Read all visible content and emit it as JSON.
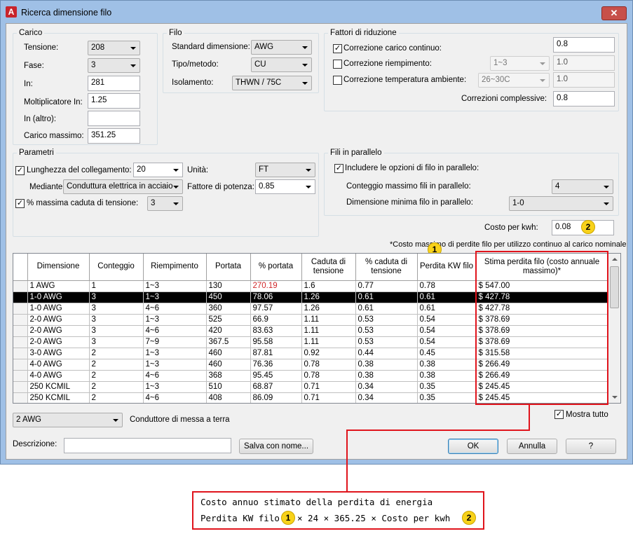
{
  "window": {
    "title": "Ricerca dimensione filo",
    "app_icon": "A",
    "close_label": "✕"
  },
  "carico": {
    "title": "Carico",
    "tensione_label": "Tensione:",
    "tensione_value": "208",
    "fase_label": "Fase:",
    "fase_value": "3",
    "in_label": "In:",
    "in_value": "281",
    "moltiplicatore_label": "Moltiplicatore In:",
    "moltiplicatore_value": "1.25",
    "in_altro_label": "In (altro):",
    "in_altro_value": "",
    "carico_massimo_label": "Carico massimo:",
    "carico_massimo_value": "351.25"
  },
  "filo": {
    "title": "Filo",
    "standard_label": "Standard dimensione:",
    "standard_value": "AWG",
    "tipo_label": "Tipo/metodo:",
    "tipo_value": "CU",
    "isolamento_label": "Isolamento:",
    "isolamento_value": "THWN / 75C"
  },
  "fattori": {
    "title": "Fattori di riduzione",
    "carico_continuo_label": "Correzione carico continuo:",
    "carico_continuo_checked": true,
    "carico_continuo_value": "0.8",
    "riempimento_label": "Correzione riempimento:",
    "riempimento_checked": false,
    "riempimento_combo": "1~3",
    "riempimento_value": "1.0",
    "temperatura_label": "Correzione temperatura ambiente:",
    "temperatura_checked": false,
    "temperatura_combo": "26~30C",
    "temperatura_value": "1.0",
    "complessive_label": "Correzioni complessive:",
    "complessive_value": "0.8"
  },
  "parametri": {
    "title": "Parametri",
    "lunghezza_label": "Lunghezza del collegamento:",
    "lunghezza_checked": true,
    "lunghezza_value": "20",
    "unita_label": "Unità:",
    "unita_value": "FT",
    "mediante_label": "Mediante:",
    "mediante_value": "Conduttura elettrica in acciaio",
    "fattore_potenza_label": "Fattore di potenza:",
    "fattore_potenza_value": "0.85",
    "caduta_label": "% massima caduta di tensione:",
    "caduta_checked": true,
    "caduta_value": "3"
  },
  "parallelo": {
    "title": "Fili in parallelo",
    "includere_label": "Includere le opzioni di filo in parallelo:",
    "includere_checked": true,
    "conteggio_label": "Conteggio massimo fili in parallelo:",
    "conteggio_value": "4",
    "dimensione_label": "Dimensione minima filo in parallelo:",
    "dimensione_value": "1-0"
  },
  "costo": {
    "label": "Costo per kwh:",
    "value": "0.08"
  },
  "footnote": "*Costo massimo di perdite filo per utilizzo continuo al carico nominale",
  "badges": {
    "one": "1",
    "two": "2"
  },
  "table": {
    "headers": [
      "Dimensione",
      "Conteggio",
      "Riempimento",
      "Portata",
      "% portata",
      "Caduta di tensione",
      "% caduta di tensione",
      "Perdita KW filo",
      "Stima perdita filo (costo annuale massimo)*"
    ],
    "rows": [
      [
        "1 AWG",
        "1",
        "1~3",
        "130",
        "270.19",
        "1.6",
        "0.77",
        "0.78",
        "$ 547.00"
      ],
      [
        "1-0 AWG",
        "3",
        "1~3",
        "450",
        "78.06",
        "1.26",
        "0.61",
        "0.61",
        "$ 427.78"
      ],
      [
        "1-0 AWG",
        "3",
        "4~6",
        "360",
        "97.57",
        "1.26",
        "0.61",
        "0.61",
        "$ 427.78"
      ],
      [
        "2-0 AWG",
        "3",
        "1~3",
        "525",
        "66.9",
        "1.11",
        "0.53",
        "0.54",
        "$ 378.69"
      ],
      [
        "2-0 AWG",
        "3",
        "4~6",
        "420",
        "83.63",
        "1.11",
        "0.53",
        "0.54",
        "$ 378.69"
      ],
      [
        "2-0 AWG",
        "3",
        "7~9",
        "367.5",
        "95.58",
        "1.11",
        "0.53",
        "0.54",
        "$ 378.69"
      ],
      [
        "3-0 AWG",
        "2",
        "1~3",
        "460",
        "87.81",
        "0.92",
        "0.44",
        "0.45",
        "$ 315.58"
      ],
      [
        "4-0 AWG",
        "2",
        "1~3",
        "460",
        "76.36",
        "0.78",
        "0.38",
        "0.38",
        "$ 266.49"
      ],
      [
        "4-0 AWG",
        "2",
        "4~6",
        "368",
        "95.45",
        "0.78",
        "0.38",
        "0.38",
        "$ 266.49"
      ],
      [
        "250 KCMIL",
        "2",
        "1~3",
        "510",
        "68.87",
        "0.71",
        "0.34",
        "0.35",
        "$ 245.45"
      ],
      [
        "250 KCMIL",
        "2",
        "4~6",
        "408",
        "86.09",
        "0.71",
        "0.34",
        "0.35",
        "$ 245.45"
      ]
    ],
    "selected_row": 1,
    "highlight_cell": {
      "row": 0,
      "col": 4,
      "color": "#d0282a"
    }
  },
  "bottom": {
    "terra_value": "2 AWG",
    "terra_label": "Conduttore di messa a terra",
    "mostra_label": "Mostra tutto",
    "mostra_checked": true,
    "descrizione_label": "Descrizione:",
    "descrizione_value": "",
    "salva_label": "Salva con nome...",
    "ok_label": "OK",
    "annulla_label": "Annulla",
    "help_label": "?"
  },
  "callout": {
    "line1": "Costo annuo stimato della perdita di energia",
    "line2_a": "Perdita KW filo",
    "line2_b": "× 24 × 365.25 × Costo per kwh"
  },
  "colors": {
    "accent_red": "#e0141c",
    "badge_yellow": "#f8d21a",
    "window_frame": "#9fc0e6"
  }
}
